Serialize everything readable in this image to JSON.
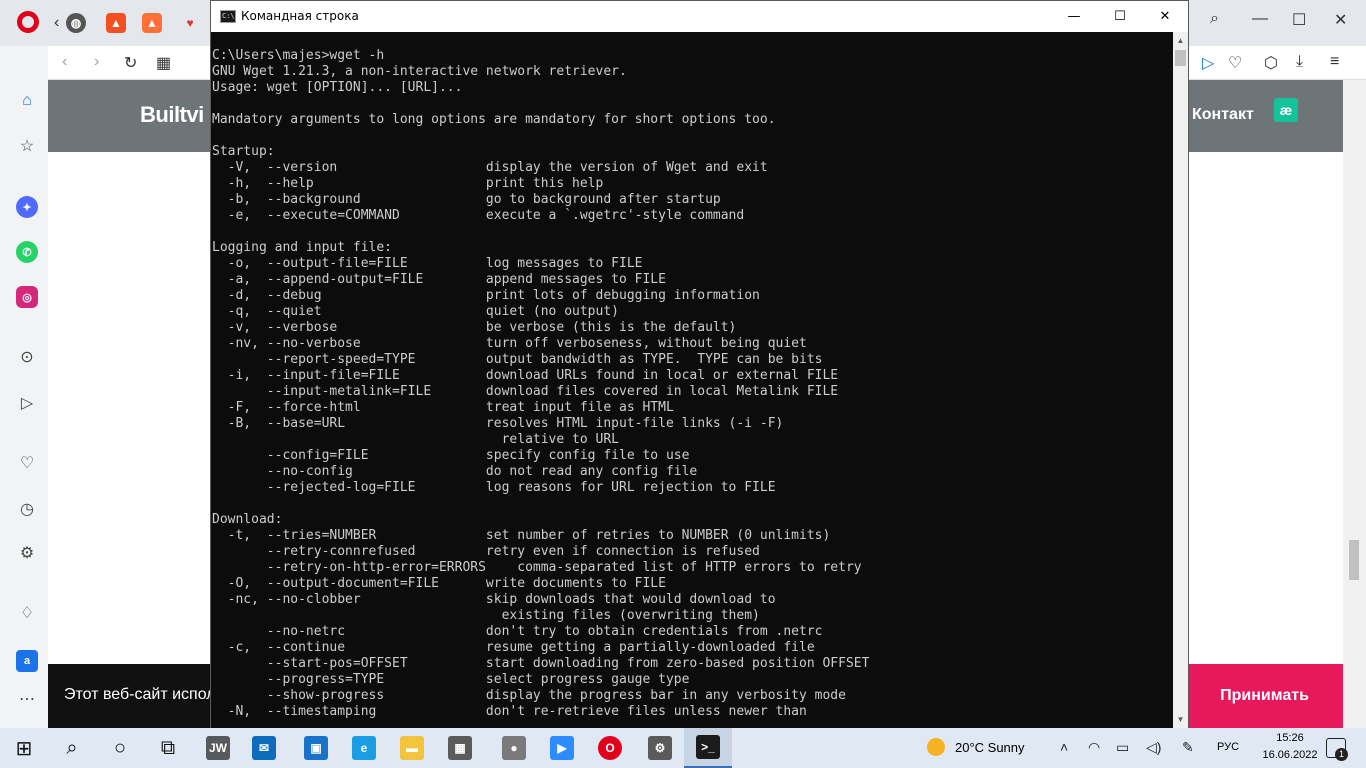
{
  "browser": {
    "site_logo": "Builtvi",
    "nav_contact": "Контакт",
    "brand_badge": "æ",
    "cookie_text": "Этот веб-сайт испол",
    "cookie_accept": "Принимать",
    "tab_icons": [
      "opera",
      "web",
      "brave",
      "vivaldi"
    ],
    "sidebar_icons": [
      "home-icon",
      "star-icon",
      "messenger-icon",
      "whatsapp-icon",
      "instagram-icon",
      "player-icon",
      "send-icon",
      "heart-icon",
      "history-icon",
      "settings-icon",
      "lightbulb-icon",
      "translate-icon",
      "more-icon"
    ]
  },
  "cmd": {
    "title": "Командная строка",
    "lines": [
      "C:\\Users\\majes>wget -h",
      "GNU Wget 1.21.3, a non-interactive network retriever.",
      "Usage: wget [OPTION]... [URL]...",
      "",
      "Mandatory arguments to long options are mandatory for short options too.",
      "",
      "Startup:",
      "  -V,  --version                   display the version of Wget and exit",
      "  -h,  --help                      print this help",
      "  -b,  --background                go to background after startup",
      "  -e,  --execute=COMMAND           execute a `.wgetrc'-style command",
      "",
      "Logging and input file:",
      "  -o,  --output-file=FILE          log messages to FILE",
      "  -a,  --append-output=FILE        append messages to FILE",
      "  -d,  --debug                     print lots of debugging information",
      "  -q,  --quiet                     quiet (no output)",
      "  -v,  --verbose                   be verbose (this is the default)",
      "  -nv, --no-verbose                turn off verboseness, without being quiet",
      "       --report-speed=TYPE         output bandwidth as TYPE.  TYPE can be bits",
      "  -i,  --input-file=FILE           download URLs found in local or external FILE",
      "       --input-metalink=FILE       download files covered in local Metalink FILE",
      "  -F,  --force-html                treat input file as HTML",
      "  -B,  --base=URL                  resolves HTML input-file links (-i -F)",
      "                                     relative to URL",
      "       --config=FILE               specify config file to use",
      "       --no-config                 do not read any config file",
      "       --rejected-log=FILE         log reasons for URL rejection to FILE",
      "",
      "Download:",
      "  -t,  --tries=NUMBER              set number of retries to NUMBER (0 unlimits)",
      "       --retry-connrefused         retry even if connection is refused",
      "       --retry-on-http-error=ERRORS    comma-separated list of HTTP errors to retry",
      "  -O,  --output-document=FILE      write documents to FILE",
      "  -nc, --no-clobber                skip downloads that would download to",
      "                                     existing files (overwriting them)",
      "       --no-netrc                  don't try to obtain credentials from .netrc",
      "  -c,  --continue                  resume getting a partially-downloaded file",
      "       --start-pos=OFFSET          start downloading from zero-based position OFFSET",
      "       --progress=TYPE             select progress gauge type",
      "       --show-progress             display the progress bar in any verbosity mode",
      "  -N,  --timestamping              don't re-retrieve files unless newer than"
    ]
  },
  "taskbar": {
    "apps": [
      {
        "name": "start-button",
        "glyph": "⊞"
      },
      {
        "name": "search-button",
        "glyph": "⌕"
      },
      {
        "name": "cortana-button",
        "glyph": "○"
      },
      {
        "name": "task-view-button",
        "glyph": "⧉"
      },
      {
        "name": "jw-app",
        "glyph": "JW",
        "color": "#58595b"
      },
      {
        "name": "mail-app",
        "glyph": "✉",
        "color": "#0f6cbd"
      },
      {
        "name": "store-app",
        "glyph": "▣",
        "color": "#1a73c9"
      },
      {
        "name": "edge-app",
        "glyph": "e",
        "color": "#1b9de2"
      },
      {
        "name": "explorer-app",
        "glyph": "▬",
        "color": "#f2c53d"
      },
      {
        "name": "calculator-app",
        "glyph": "▦",
        "color": "#5b5b5b"
      },
      {
        "name": "voice-recorder-app",
        "glyph": "●",
        "color": "#7a7a7a"
      },
      {
        "name": "zoom-app",
        "glyph": "▶",
        "color": "#2d8cff"
      },
      {
        "name": "opera-app",
        "glyph": "O",
        "color": "#e0001b"
      },
      {
        "name": "settings-app",
        "glyph": "⚙",
        "color": "#5a5a5a"
      },
      {
        "name": "cmd-app",
        "glyph": ">_",
        "color": "#1b1b1b"
      }
    ],
    "weather": "20°C  Sunny",
    "language": "РУС",
    "time": "15:26",
    "date": "16.06.2022",
    "notification_count": "1"
  }
}
